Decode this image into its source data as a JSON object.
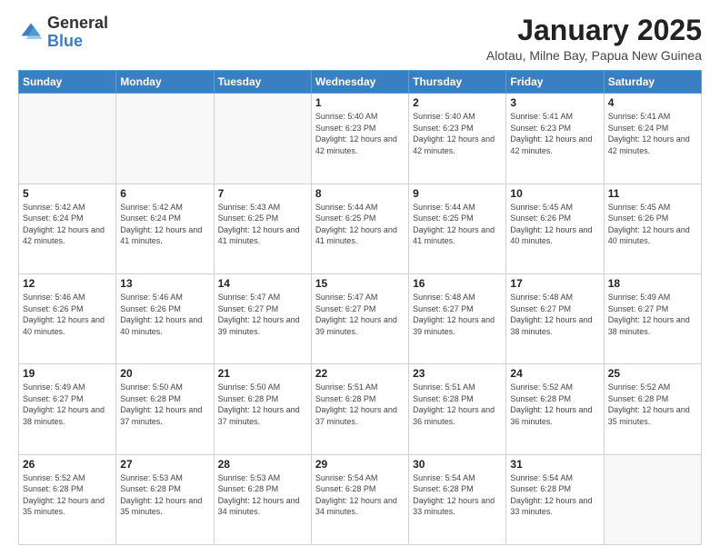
{
  "header": {
    "logo_general": "General",
    "logo_blue": "Blue",
    "title": "January 2025",
    "subtitle": "Alotau, Milne Bay, Papua New Guinea"
  },
  "weekdays": [
    "Sunday",
    "Monday",
    "Tuesday",
    "Wednesday",
    "Thursday",
    "Friday",
    "Saturday"
  ],
  "weeks": [
    [
      {
        "day": "",
        "info": ""
      },
      {
        "day": "",
        "info": ""
      },
      {
        "day": "",
        "info": ""
      },
      {
        "day": "1",
        "info": "Sunrise: 5:40 AM\nSunset: 6:23 PM\nDaylight: 12 hours\nand 42 minutes."
      },
      {
        "day": "2",
        "info": "Sunrise: 5:40 AM\nSunset: 6:23 PM\nDaylight: 12 hours\nand 42 minutes."
      },
      {
        "day": "3",
        "info": "Sunrise: 5:41 AM\nSunset: 6:23 PM\nDaylight: 12 hours\nand 42 minutes."
      },
      {
        "day": "4",
        "info": "Sunrise: 5:41 AM\nSunset: 6:24 PM\nDaylight: 12 hours\nand 42 minutes."
      }
    ],
    [
      {
        "day": "5",
        "info": "Sunrise: 5:42 AM\nSunset: 6:24 PM\nDaylight: 12 hours\nand 42 minutes."
      },
      {
        "day": "6",
        "info": "Sunrise: 5:42 AM\nSunset: 6:24 PM\nDaylight: 12 hours\nand 41 minutes."
      },
      {
        "day": "7",
        "info": "Sunrise: 5:43 AM\nSunset: 6:25 PM\nDaylight: 12 hours\nand 41 minutes."
      },
      {
        "day": "8",
        "info": "Sunrise: 5:44 AM\nSunset: 6:25 PM\nDaylight: 12 hours\nand 41 minutes."
      },
      {
        "day": "9",
        "info": "Sunrise: 5:44 AM\nSunset: 6:25 PM\nDaylight: 12 hours\nand 41 minutes."
      },
      {
        "day": "10",
        "info": "Sunrise: 5:45 AM\nSunset: 6:26 PM\nDaylight: 12 hours\nand 40 minutes."
      },
      {
        "day": "11",
        "info": "Sunrise: 5:45 AM\nSunset: 6:26 PM\nDaylight: 12 hours\nand 40 minutes."
      }
    ],
    [
      {
        "day": "12",
        "info": "Sunrise: 5:46 AM\nSunset: 6:26 PM\nDaylight: 12 hours\nand 40 minutes."
      },
      {
        "day": "13",
        "info": "Sunrise: 5:46 AM\nSunset: 6:26 PM\nDaylight: 12 hours\nand 40 minutes."
      },
      {
        "day": "14",
        "info": "Sunrise: 5:47 AM\nSunset: 6:27 PM\nDaylight: 12 hours\nand 39 minutes."
      },
      {
        "day": "15",
        "info": "Sunrise: 5:47 AM\nSunset: 6:27 PM\nDaylight: 12 hours\nand 39 minutes."
      },
      {
        "day": "16",
        "info": "Sunrise: 5:48 AM\nSunset: 6:27 PM\nDaylight: 12 hours\nand 39 minutes."
      },
      {
        "day": "17",
        "info": "Sunrise: 5:48 AM\nSunset: 6:27 PM\nDaylight: 12 hours\nand 38 minutes."
      },
      {
        "day": "18",
        "info": "Sunrise: 5:49 AM\nSunset: 6:27 PM\nDaylight: 12 hours\nand 38 minutes."
      }
    ],
    [
      {
        "day": "19",
        "info": "Sunrise: 5:49 AM\nSunset: 6:27 PM\nDaylight: 12 hours\nand 38 minutes."
      },
      {
        "day": "20",
        "info": "Sunrise: 5:50 AM\nSunset: 6:28 PM\nDaylight: 12 hours\nand 37 minutes."
      },
      {
        "day": "21",
        "info": "Sunrise: 5:50 AM\nSunset: 6:28 PM\nDaylight: 12 hours\nand 37 minutes."
      },
      {
        "day": "22",
        "info": "Sunrise: 5:51 AM\nSunset: 6:28 PM\nDaylight: 12 hours\nand 37 minutes."
      },
      {
        "day": "23",
        "info": "Sunrise: 5:51 AM\nSunset: 6:28 PM\nDaylight: 12 hours\nand 36 minutes."
      },
      {
        "day": "24",
        "info": "Sunrise: 5:52 AM\nSunset: 6:28 PM\nDaylight: 12 hours\nand 36 minutes."
      },
      {
        "day": "25",
        "info": "Sunrise: 5:52 AM\nSunset: 6:28 PM\nDaylight: 12 hours\nand 35 minutes."
      }
    ],
    [
      {
        "day": "26",
        "info": "Sunrise: 5:52 AM\nSunset: 6:28 PM\nDaylight: 12 hours\nand 35 minutes."
      },
      {
        "day": "27",
        "info": "Sunrise: 5:53 AM\nSunset: 6:28 PM\nDaylight: 12 hours\nand 35 minutes."
      },
      {
        "day": "28",
        "info": "Sunrise: 5:53 AM\nSunset: 6:28 PM\nDaylight: 12 hours\nand 34 minutes."
      },
      {
        "day": "29",
        "info": "Sunrise: 5:54 AM\nSunset: 6:28 PM\nDaylight: 12 hours\nand 34 minutes."
      },
      {
        "day": "30",
        "info": "Sunrise: 5:54 AM\nSunset: 6:28 PM\nDaylight: 12 hours\nand 33 minutes."
      },
      {
        "day": "31",
        "info": "Sunrise: 5:54 AM\nSunset: 6:28 PM\nDaylight: 12 hours\nand 33 minutes."
      },
      {
        "day": "",
        "info": ""
      }
    ]
  ]
}
